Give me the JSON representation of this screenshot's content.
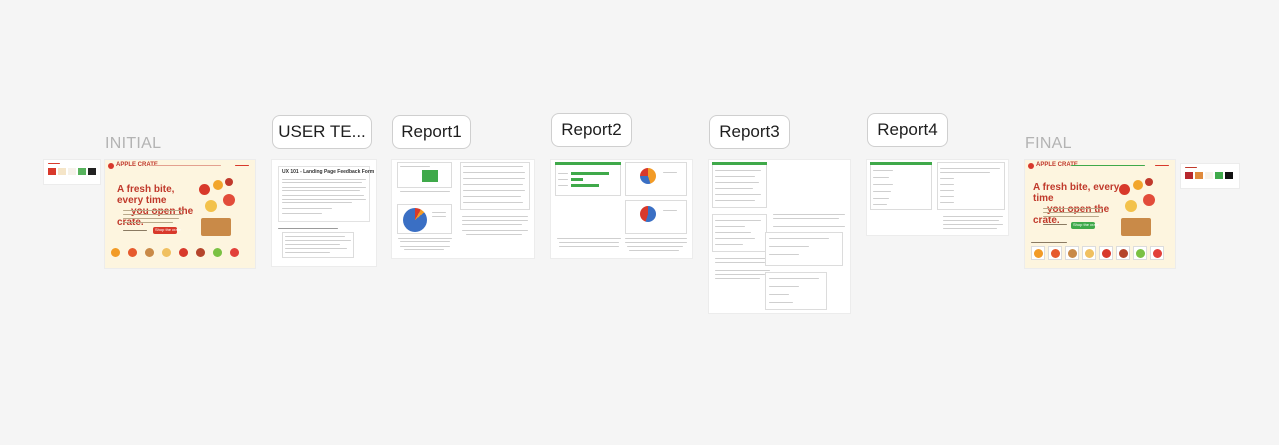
{
  "canvas": {
    "background": "#f5f5f5"
  },
  "frames": {
    "initial_label": "INITIAL",
    "final_label": "FINAL"
  },
  "tags": [
    {
      "label": "USER TE..."
    },
    {
      "label": "Report1"
    },
    {
      "label": "Report2"
    },
    {
      "label": "Report3"
    },
    {
      "label": "Report4"
    }
  ],
  "initial_page": {
    "brand": "APPLE CRATE",
    "hero_line1": "A fresh bite, every time",
    "hero_line2": "you open the crate.",
    "cta": "Shop the crate"
  },
  "final_page": {
    "brand": "APPLE CRATE",
    "hero_line1": "A fresh bite, every time",
    "hero_line2": "you open the crate.",
    "cta": "Shop the crate"
  },
  "user_test": {
    "title": "UX 101 - Landing Page Feedback Form"
  },
  "colors": {
    "red": "#d8392b",
    "green": "#3fa94a",
    "cream": "#fdf5df",
    "pie_blue": "#3a6fc4",
    "pie_orange": "#f29b26",
    "pie_red": "#d8392b"
  }
}
